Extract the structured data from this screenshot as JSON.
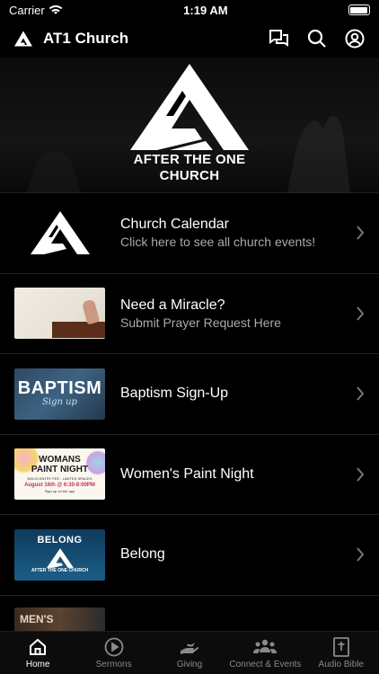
{
  "status": {
    "carrier": "Carrier",
    "time": "1:19 AM"
  },
  "navbar": {
    "title": "AT1 Church"
  },
  "hero": {
    "name_line1": "AFTER THE ONE",
    "name_line2": "CHURCH"
  },
  "rows": [
    {
      "title": "Church Calendar",
      "subtitle": "Click here to see all church events!"
    },
    {
      "title": "Need a Miracle?",
      "subtitle": "Submit Prayer Request Here"
    },
    {
      "title": "Baptism Sign-Up"
    },
    {
      "title": "Women's Paint Night"
    },
    {
      "title": "Belong"
    }
  ],
  "thumbs": {
    "baptism_main": "BAPTISM",
    "baptism_sub": "Sign up",
    "paint_line1": "WOMANS",
    "paint_line2": "PAINT NIGHT",
    "paint_line3": "$25.00 ENTRY FEE - LIMITED SPACES",
    "paint_line4": "August 16th @ 6:30-8:00PM",
    "paint_line5": "Sign up on the app",
    "belong_title": "BELONG",
    "belong_caption": "AFTER THE ONE CHURCH",
    "mens_text": "MEN'S"
  },
  "tabs": [
    {
      "label": "Home",
      "icon": "home-icon",
      "active": true
    },
    {
      "label": "Sermons",
      "icon": "play-icon"
    },
    {
      "label": "Giving",
      "icon": "giving-hand-icon"
    },
    {
      "label": "Connect & Events",
      "icon": "people-icon"
    },
    {
      "label": "Audio Bible",
      "icon": "bible-icon"
    }
  ],
  "colors": {
    "background": "#000000",
    "inactive_tab": "#8a8a8a",
    "divider": "#222222"
  }
}
